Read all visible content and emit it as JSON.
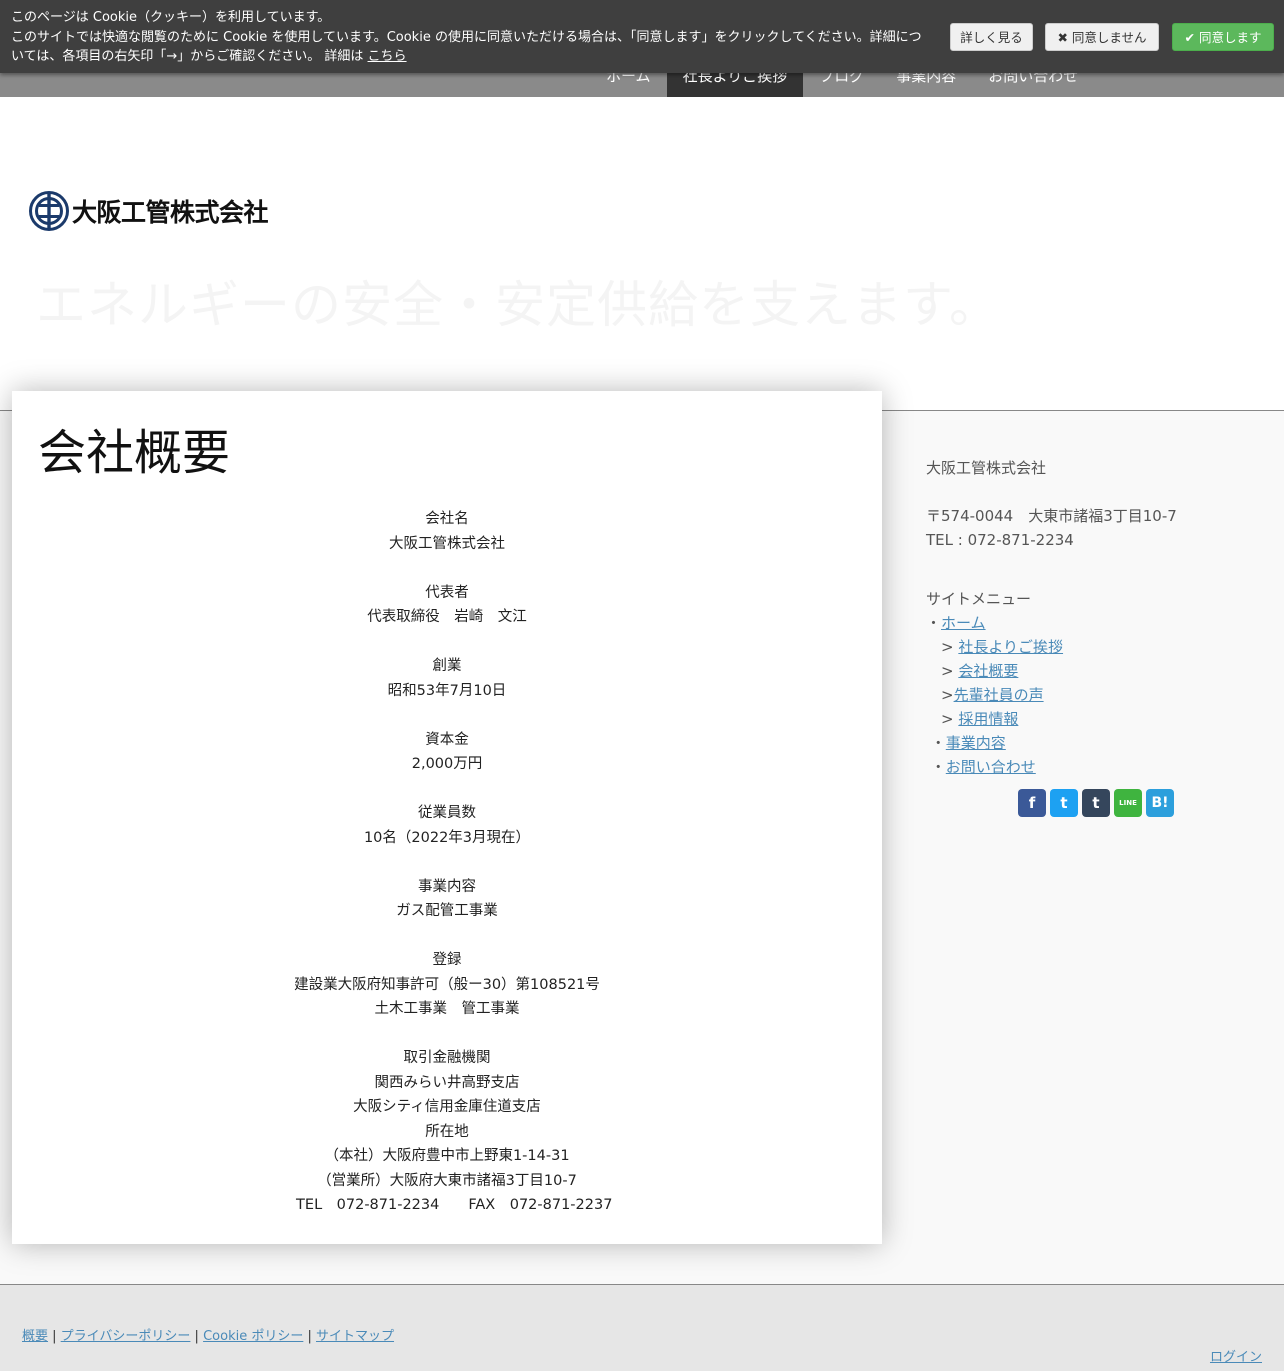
{
  "cookie": {
    "line1": "このページは Cookie（クッキー）を利用しています。",
    "line2": "このサイトでは快適な閲覧のために Cookie を使用しています。Cookie の使用に同意いただける場合は、「同意します」をクリックしてください。詳細につ",
    "line3": "いては、各項目の右矢印「→」からご確認ください。 詳細は",
    "link": "こちら",
    "btn_more": "詳しく見る",
    "btn_decline": "✖ 同意しません",
    "btn_accept": "✔ 同意します"
  },
  "nav": {
    "items": [
      "ホーム",
      "社長よりご挨拶",
      "ブログ",
      "事業内容",
      "お問い合わせ"
    ],
    "active_index": 1
  },
  "header": {
    "logo_text": "大阪工管株式会社",
    "tagline": "エネルギーの安全・安定供給を支えます。"
  },
  "main": {
    "title": "会社概要",
    "sections": [
      {
        "label": "会社名",
        "values": [
          "大阪工管株式会社"
        ]
      },
      {
        "label": "代表者",
        "values": [
          "代表取締役　岩崎　文江"
        ]
      },
      {
        "label": "創業",
        "values": [
          "昭和53年7月10日"
        ]
      },
      {
        "label": "資本金",
        "values": [
          "2,000万円"
        ]
      },
      {
        "label": "従業員数",
        "values": [
          "10名（2022年3月現在）"
        ]
      },
      {
        "label": "事業内容",
        "values": [
          "ガス配管工事業"
        ]
      },
      {
        "label": "登録",
        "values": [
          "建設業大阪府知事許可（般ー30）第108521号",
          "土木工事業　管工事業"
        ]
      },
      {
        "label": "取引金融機関",
        "values": [
          "関西みらい井高野支店",
          "大阪シティ信用金庫住道支店"
        ],
        "no_gap_after": true
      },
      {
        "label": "所在地",
        "values": [
          "（本社）大阪府豊中市上野東1-14-31",
          "（営業所）大阪府大東市諸福3丁目10-7",
          "　TEL　072-871-2234　　FAX　072-871-2237"
        ]
      }
    ]
  },
  "sidebar": {
    "company": "大阪工管株式会社",
    "address": "〒574-0044　大東市諸福3丁目10-7",
    "tel": "TEL : 072-871-2234",
    "menu_title": "サイトメニュー",
    "home": "ホーム",
    "greeting": "社長よりご挨拶",
    "overview": "会社概要",
    "voices": "先輩社員の声",
    "recruit": "採用情報",
    "business": "事業内容",
    "contact": "お問い合わせ"
  },
  "social": {
    "facebook": "f",
    "twitter": "t",
    "tumblr": "t",
    "line": "LINE",
    "hatena": "B!"
  },
  "footer": {
    "links": [
      "概要",
      "プライバシーポリシー",
      "Cookie ポリシー",
      "サイトマップ"
    ],
    "login": "ログイン"
  },
  "colors": {
    "nav_bg": "#8a8a8a",
    "nav_active": "#333333",
    "cookie_bg": "#3f3f3f",
    "accept_green": "#5cb85c",
    "link_blue": "#4a8ab8",
    "logo_navy": "#1b3a6b"
  }
}
